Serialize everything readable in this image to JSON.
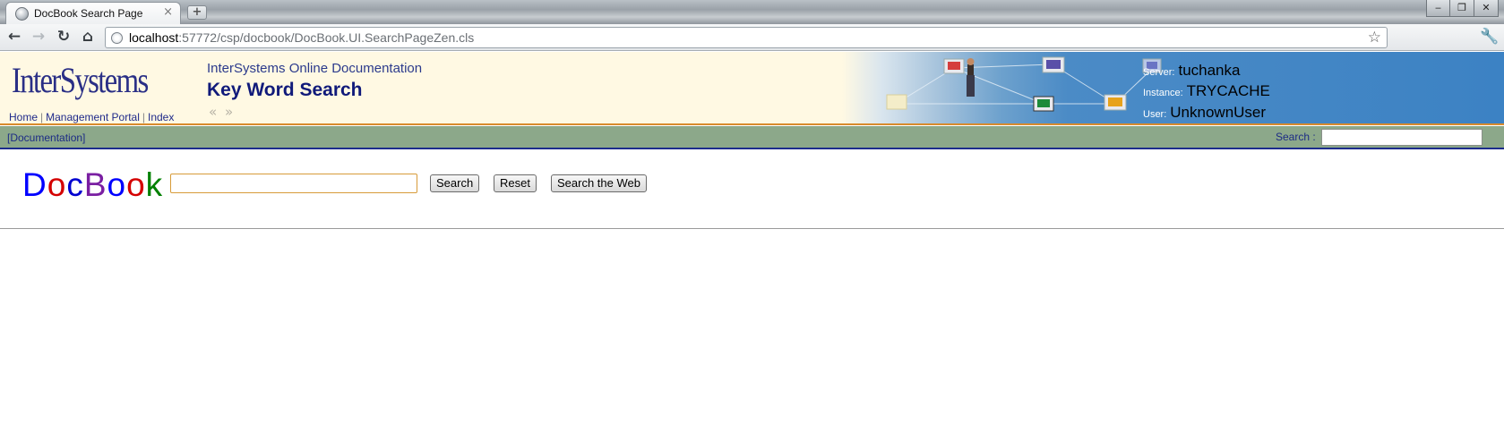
{
  "browser": {
    "tab_title": "DocBook Search Page",
    "tab_close": "×",
    "new_tab": "+",
    "window_buttons": [
      "‒",
      "❐",
      "✕"
    ],
    "nav": {
      "back": "←",
      "forward": "→",
      "reload": "↻",
      "home": "⌂"
    },
    "url_host": "localhost",
    "url_rest": ":57772/csp/docbook/DocBook.UI.SearchPageZen.cls",
    "star": "☆",
    "wrench": "🔧"
  },
  "header": {
    "logo": "InterSystems",
    "links": [
      "Home",
      "Management Portal",
      "Index"
    ],
    "subtitle": "InterSystems Online Documentation",
    "title": "Key Word Search",
    "arrows": "« »",
    "server_label": "Server:",
    "server_value": "tuchanka",
    "instance_label": "Instance:",
    "instance_value": "TRYCACHE",
    "user_label": "User:",
    "user_value": "UnknownUser"
  },
  "bar": {
    "documentation_link": "[Documentation]",
    "search_label": "Search :",
    "search_value": ""
  },
  "main": {
    "docbook_letters": [
      "D",
      "o",
      "c",
      "B",
      "o",
      "o",
      "k"
    ],
    "docbook_colors": [
      "#0000ff",
      "#d40000",
      "#0000d0",
      "#7a1fa2",
      "#0000ff",
      "#d40000",
      "#008000"
    ],
    "search_value": "",
    "search_button": "Search",
    "reset_button": "Reset",
    "web_button": "Search the Web"
  }
}
